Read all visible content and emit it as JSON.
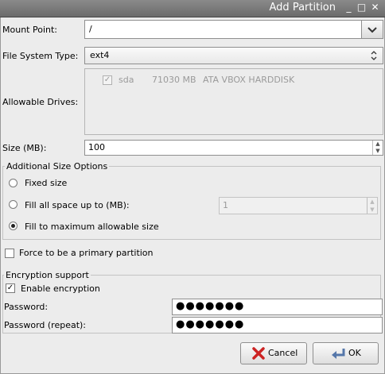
{
  "window": {
    "title": "Add Partition",
    "buttons": [
      "_",
      "□",
      "✕"
    ]
  },
  "form": {
    "mount_point_label": "Mount Point:",
    "mount_point_value": "/",
    "fs_type_label": "File System Type:",
    "fs_type_value": "ext4",
    "allowable_drives_label": "Allowable Drives:",
    "drive": {
      "name": "sda",
      "size": "71030 MB",
      "model": "ATA VBOX HARDDISK",
      "checked": true
    },
    "size_label": "Size (MB):",
    "size_value": "100"
  },
  "size_options": {
    "title": "Additional Size Options",
    "fixed_label": "Fixed size",
    "fill_upto_label": "Fill all space up to (MB):",
    "fill_upto_value": "1",
    "fill_max_label": "Fill to maximum allowable size",
    "selected": "fill_max"
  },
  "primary": {
    "label": "Force to be a primary partition",
    "checked": false
  },
  "encryption": {
    "title": "Encryption support",
    "enable_label": "Enable encryption",
    "enabled": true,
    "password_label": "Password:",
    "password_value": "●●●●●●●",
    "password_repeat_label": "Password (repeat):",
    "password_repeat_value": "●●●●●●●"
  },
  "buttons": {
    "cancel": "Cancel",
    "ok": "OK"
  },
  "colors": {
    "cancel_icon": "#cc2222",
    "ok_icon": "#5577aa"
  }
}
